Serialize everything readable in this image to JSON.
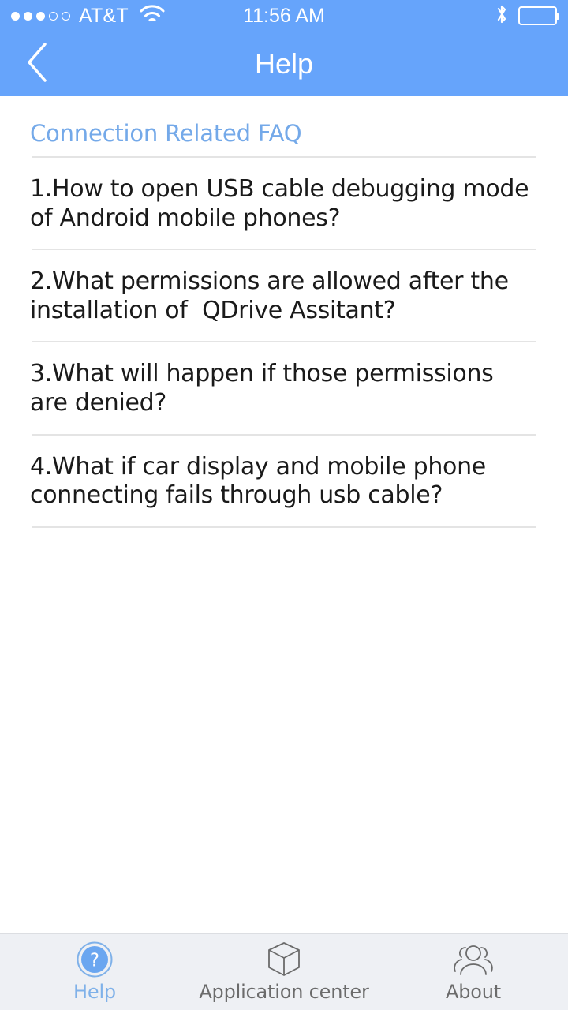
{
  "status_bar": {
    "signal_dots_filled": 3,
    "signal_dots_empty": 2,
    "carrier": "AT&T",
    "wifi_icon": "wifi-icon",
    "time": "11:56 AM",
    "bluetooth_icon": "bluetooth-icon",
    "battery_icon": "battery-icon"
  },
  "nav": {
    "back_icon": "chevron-left-icon",
    "title": "Help"
  },
  "content": {
    "section_title": "Connection Related FAQ",
    "faq_items": [
      "1.How to open USB cable debugging mode of Android mobile phones?",
      "2.What permissions are allowed after the installation of  QDrive Assitant?",
      "3.What will happen if those permissions are denied?",
      "4.What if car display and mobile phone connecting fails through usb cable?"
    ]
  },
  "tab_bar": {
    "tabs": [
      {
        "label": "Help",
        "icon": "question-circle-icon",
        "active": true
      },
      {
        "label": "Application center",
        "icon": "cube-box-icon",
        "active": false
      },
      {
        "label": "About",
        "icon": "people-group-icon",
        "active": false
      }
    ]
  },
  "colors": {
    "header_blue": "#66a4fb",
    "accent_blue": "#74a9e9",
    "tab_bar_bg": "#eef0f4",
    "divider": "#e4e4e4",
    "body_text": "#1a1a1a"
  }
}
